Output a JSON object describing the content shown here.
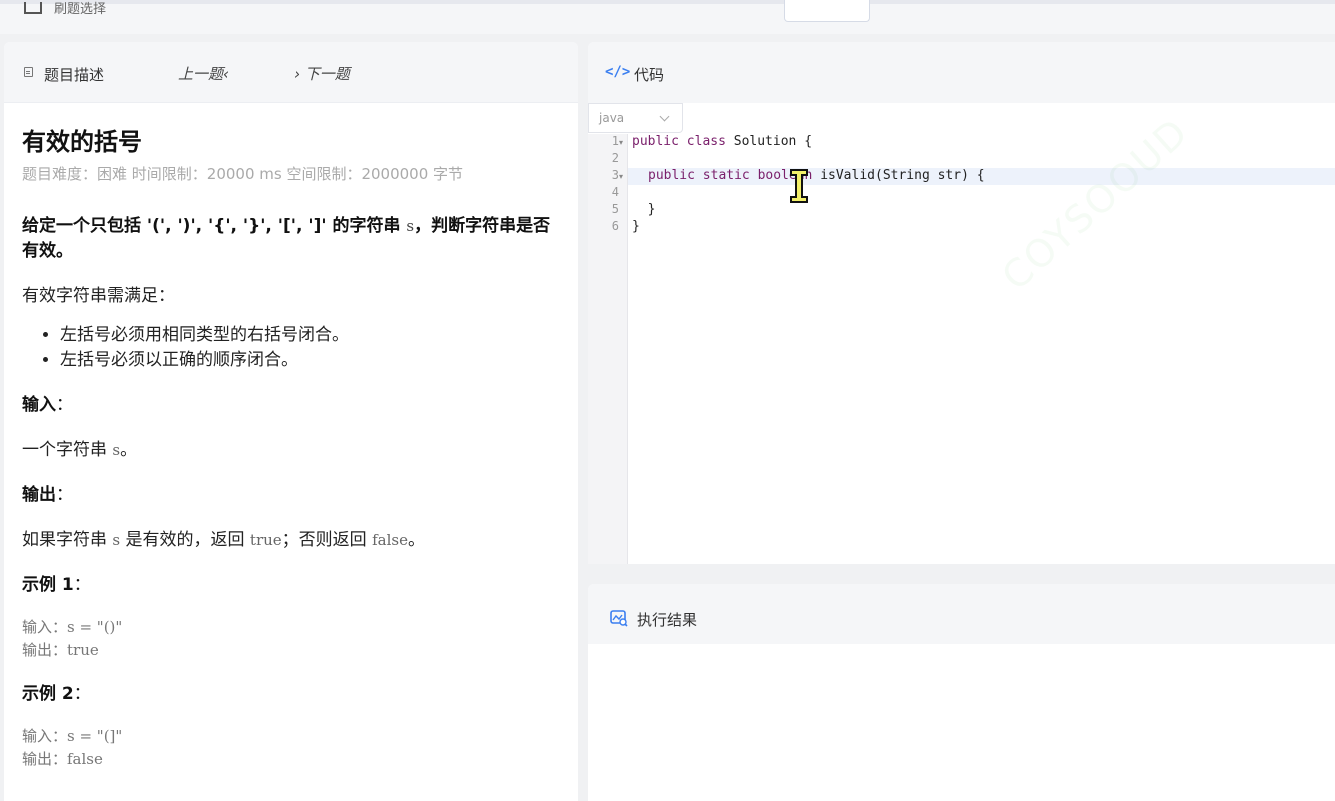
{
  "topbar": {
    "title": "刷题选择"
  },
  "left": {
    "tab_label": "题目描述",
    "prev_label": "上一题‹",
    "next_label": "› 下一题",
    "title": "有效的括号",
    "meta": "题目难度：困难 时间限制：20000 ms 空间限制：2000000 字节",
    "question_bold": "给定一个只包括 '(', ')', '{', '}', '[', ']' 的字符串 ",
    "question_var": "s",
    "question_tail": "，判断字符串是否有效。",
    "rules_intro": "有效字符串需满足：",
    "rules": [
      "左括号必须用相同类型的右括号闭合。",
      "左括号必须以正确的顺序闭合。"
    ],
    "input_label": "输入",
    "input_colon": "：",
    "input_text": "一个字符串 ",
    "input_var": "s",
    "input_end": "。",
    "output_label": "输出",
    "output_colon": "：",
    "output_pre": "如果字符串 ",
    "output_var": "s",
    "output_mid": " 是有效的，返回 ",
    "output_true": "true",
    "output_mid2": "；否则返回 ",
    "output_false": "false",
    "output_end": "。",
    "example1_label": "示例 1",
    "example1_colon": "：",
    "example1_body": "输入：s = \"()\"\n输出：true",
    "example2_label": "示例 2",
    "example2_colon": "：",
    "example2_body": "输入：s = \"(]\"\n输出：false"
  },
  "code": {
    "header_icon": "</>",
    "header_label": "代码",
    "language": "java",
    "line_numbers": [
      "1",
      "2",
      "3",
      "4",
      "5",
      "6"
    ],
    "line1_kw": "public class",
    "line1_rest": " Solution {",
    "line3_kw": "public static boolean",
    "line3_rest": " isValid(String str) {",
    "line5": "  }",
    "line6": "}",
    "watermark": "COYSOOUD"
  },
  "result": {
    "header_label": "执行结果"
  },
  "colors": {
    "accent": "#3b7ff0",
    "keyword": "#7a1f6b",
    "panel_bg": "#f5f6f8",
    "page_bg": "#f0f1f3"
  }
}
